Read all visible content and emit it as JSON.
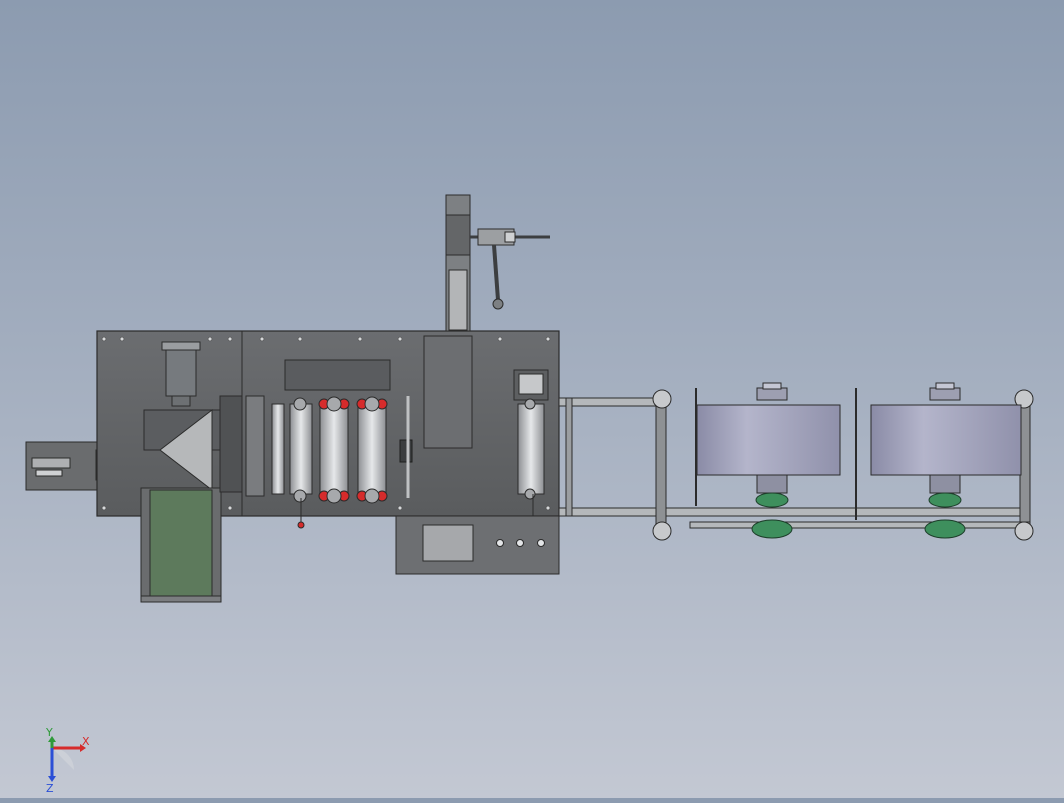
{
  "scene": {
    "background_top": "#8c9bb0",
    "background_bottom": "#c3c8d3",
    "frame_color": "#5e6163",
    "belt_color": "#5d7a5c",
    "drum_color": "#9fa0b8",
    "accent_red": "#d62b2b",
    "green_sprocket": "#3e8f5d"
  },
  "triad": {
    "x_label": "X",
    "y_label": "Y",
    "z_label": "Z",
    "x_color": "#d62b2b",
    "y_color": "#2f9a3a",
    "z_color": "#2b4fd6"
  },
  "components": [
    "infeed-platform",
    "main-frame",
    "conveyor-belt",
    "roller-assembly",
    "vertical-column",
    "control-panel",
    "outfeed-rail",
    "material-drum-left",
    "material-drum-right"
  ]
}
